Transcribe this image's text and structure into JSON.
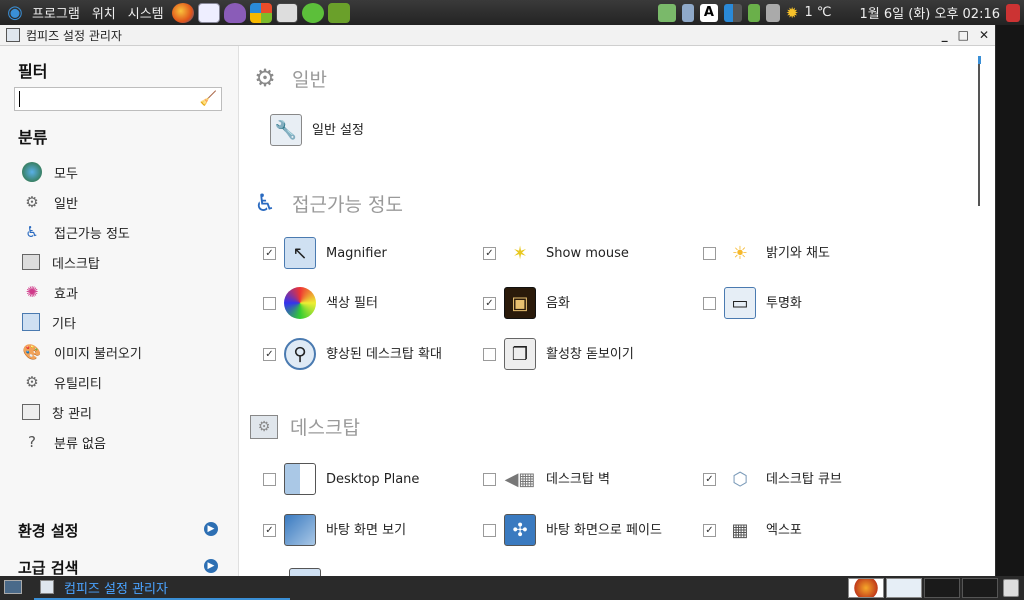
{
  "topbar": {
    "menu": [
      "프로그램",
      "위치",
      "시스템"
    ],
    "weather": "1 ℃",
    "clock": "1월  6일 (화) 오후 02:16",
    "tray_letter": "A"
  },
  "window": {
    "title": "컴피즈 설정 관리자"
  },
  "sidebar": {
    "filter_label": "필터",
    "filter_value": "",
    "category_label": "분류",
    "categories": [
      {
        "label": "모두",
        "icon": "globe-icon"
      },
      {
        "label": "일반",
        "icon": "gear-icon"
      },
      {
        "label": "접근가능 정도",
        "icon": "accessibility-icon"
      },
      {
        "label": "데스크탑",
        "icon": "desktop-icon"
      },
      {
        "label": "효과",
        "icon": "effects-icon"
      },
      {
        "label": "기타",
        "icon": "misc-icon"
      },
      {
        "label": "이미지 불러오기",
        "icon": "palette-icon"
      },
      {
        "label": "유틸리티",
        "icon": "utility-gear-icon"
      },
      {
        "label": "창 관리",
        "icon": "window-management-icon"
      },
      {
        "label": "분류 없음",
        "icon": "question-icon"
      }
    ],
    "preferences_label": "환경 설정",
    "advanced_search_label": "고급 검색"
  },
  "sections": {
    "general": {
      "title": "일반",
      "plugins": [
        {
          "label": "일반 설정"
        }
      ]
    },
    "accessibility": {
      "title": "접근가능 정도",
      "plugins": [
        {
          "label": "Magnifier",
          "checked": true
        },
        {
          "label": "Show mouse",
          "checked": true
        },
        {
          "label": "밝기와 채도",
          "checked": false
        },
        {
          "label": "색상 필터",
          "checked": false
        },
        {
          "label": "음화",
          "checked": true
        },
        {
          "label": "투명화",
          "checked": false
        },
        {
          "label": "향상된 데스크탑 확대",
          "checked": true
        },
        {
          "label": "활성창 돋보이기",
          "checked": false
        }
      ]
    },
    "desktop": {
      "title": "데스크탑",
      "plugins": [
        {
          "label": "Desktop Plane",
          "checked": false
        },
        {
          "label": "데스크탑 벽",
          "checked": false
        },
        {
          "label": "데스크탑 큐브",
          "checked": true
        },
        {
          "label": "바탕 화면 보기",
          "checked": true
        },
        {
          "label": "바탕 화면으로 페이드",
          "checked": false
        },
        {
          "label": "엑스포",
          "checked": true
        }
      ]
    }
  },
  "taskbar": {
    "active_task": "컴피즈 설정 관리자"
  },
  "colors": {
    "accent": "#3a8fd6",
    "section_title": "#9a9a9a"
  }
}
